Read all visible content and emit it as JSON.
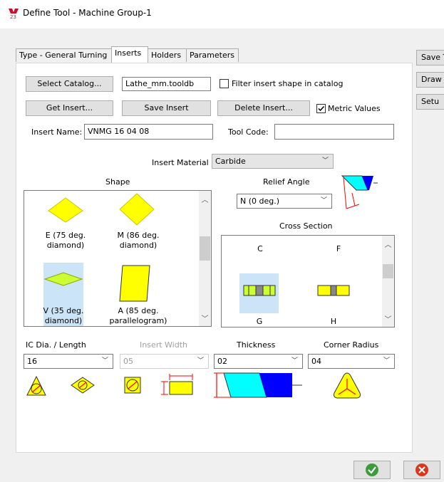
{
  "window": {
    "title": "Define Tool - Machine Group-1"
  },
  "tabs": [
    {
      "label": "Type - General Turning"
    },
    {
      "label": "Inserts"
    },
    {
      "label": "Holders"
    },
    {
      "label": "Parameters"
    }
  ],
  "side_buttons": {
    "save": "Save T",
    "draw": "Draw",
    "setup": "Setu"
  },
  "toolbar": {
    "select_catalog": "Select Catalog...",
    "catalog_file": "Lathe_mm.tooldb",
    "filter_label": "Filter insert shape in catalog",
    "get_insert": "Get Insert...",
    "save_insert": "Save Insert",
    "delete_insert": "Delete Insert...",
    "metric_label": "Metric Values"
  },
  "insert": {
    "name_label": "Insert Name:",
    "name_value": "VNMG 16 04 08",
    "tool_code_label": "Tool Code:",
    "tool_code_value": "",
    "material_label": "Insert Material",
    "material_value": "Carbide"
  },
  "shape": {
    "heading": "Shape",
    "items": [
      {
        "line1": "E (75 deg.",
        "line2": "diamond)"
      },
      {
        "line1": "M (86 deg.",
        "line2": "diamond)"
      },
      {
        "line1": "V (35 deg.",
        "line2": "diamond)"
      },
      {
        "line1": "A (85 deg.",
        "line2": "parallelogram)"
      }
    ]
  },
  "relief": {
    "heading": "Relief Angle",
    "value": "N (0 deg.)"
  },
  "cross_section": {
    "heading": "Cross Section",
    "items": [
      {
        "label": "C"
      },
      {
        "label": "F"
      },
      {
        "label": "G"
      },
      {
        "label": "H"
      }
    ]
  },
  "dims": {
    "ic_label": "IC Dia. / Length",
    "ic_value": "16",
    "width_label": "Insert Width",
    "width_value": "05",
    "thickness_label": "Thickness",
    "thickness_value": "02",
    "corner_label": "Corner Radius",
    "corner_value": "04"
  },
  "colors": {
    "insert_yellow": "#ffff00",
    "selected_bg": "#cce4f7",
    "cyan": "#00ffff",
    "blue": "#0000ff",
    "red": "#ff0000"
  }
}
